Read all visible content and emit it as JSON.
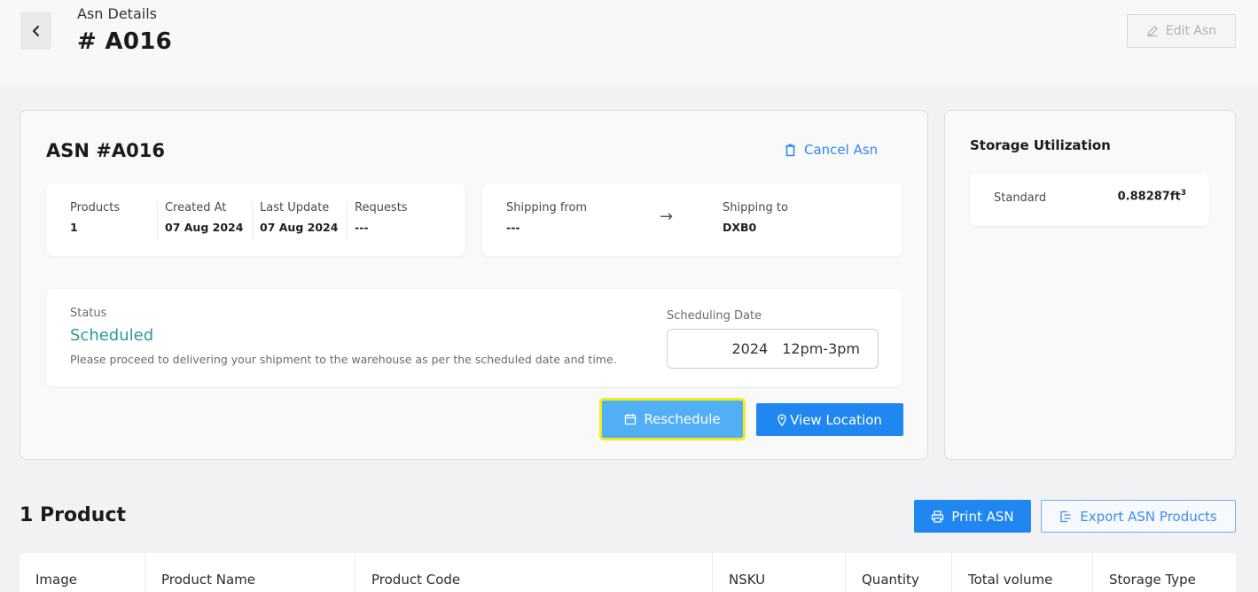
{
  "header": {
    "subtitle": "Asn Details",
    "title": "# A016",
    "back_icon": "chevron-left-icon",
    "edit_label": "Edit Asn",
    "edit_icon": "pencil-icon"
  },
  "asn_card": {
    "title": "ASN #A016",
    "cancel_label": "Cancel Asn",
    "cancel_icon": "trash-icon",
    "info": [
      {
        "label": "Products",
        "value": "1"
      },
      {
        "label": "Created At",
        "value": "07 Aug 2024"
      },
      {
        "label": "Last Update",
        "value": "07 Aug 2024"
      },
      {
        "label": "Requests",
        "value": "---"
      }
    ],
    "shipping": {
      "from_label": "Shipping from",
      "from_value": "---",
      "arrow_icon": "arrow-right-icon",
      "to_label": "Shipping to",
      "to_value": "DXB0"
    },
    "status": {
      "label": "Status",
      "value": "Scheduled",
      "description": "Please proceed to delivering your shipment to the warehouse as per the scheduled date and time.",
      "scheduling_label": "Scheduling Date",
      "scheduling_year": "2024",
      "scheduling_slot": "12pm-3pm"
    },
    "reschedule_label": "Reschedule",
    "reschedule_icon": "calendar-icon",
    "view_location_label": "View Location",
    "location_icon": "map-pin-icon"
  },
  "storage": {
    "title": "Storage Utilization",
    "label": "Standard",
    "value": "0.88287ft",
    "unit_sup": "3"
  },
  "products": {
    "title": "1 Product",
    "print_label": "Print ASN",
    "print_icon": "printer-icon",
    "export_label": "Export ASN Products",
    "export_icon": "export-icon",
    "columns": [
      "Image",
      "Product Name",
      "Product Code",
      "NSKU",
      "Quantity",
      "Total volume",
      "Storage Type"
    ]
  },
  "colors": {
    "primary": "#1f87ef",
    "status": "#2a9a96",
    "highlight": "#f2ec1a"
  }
}
